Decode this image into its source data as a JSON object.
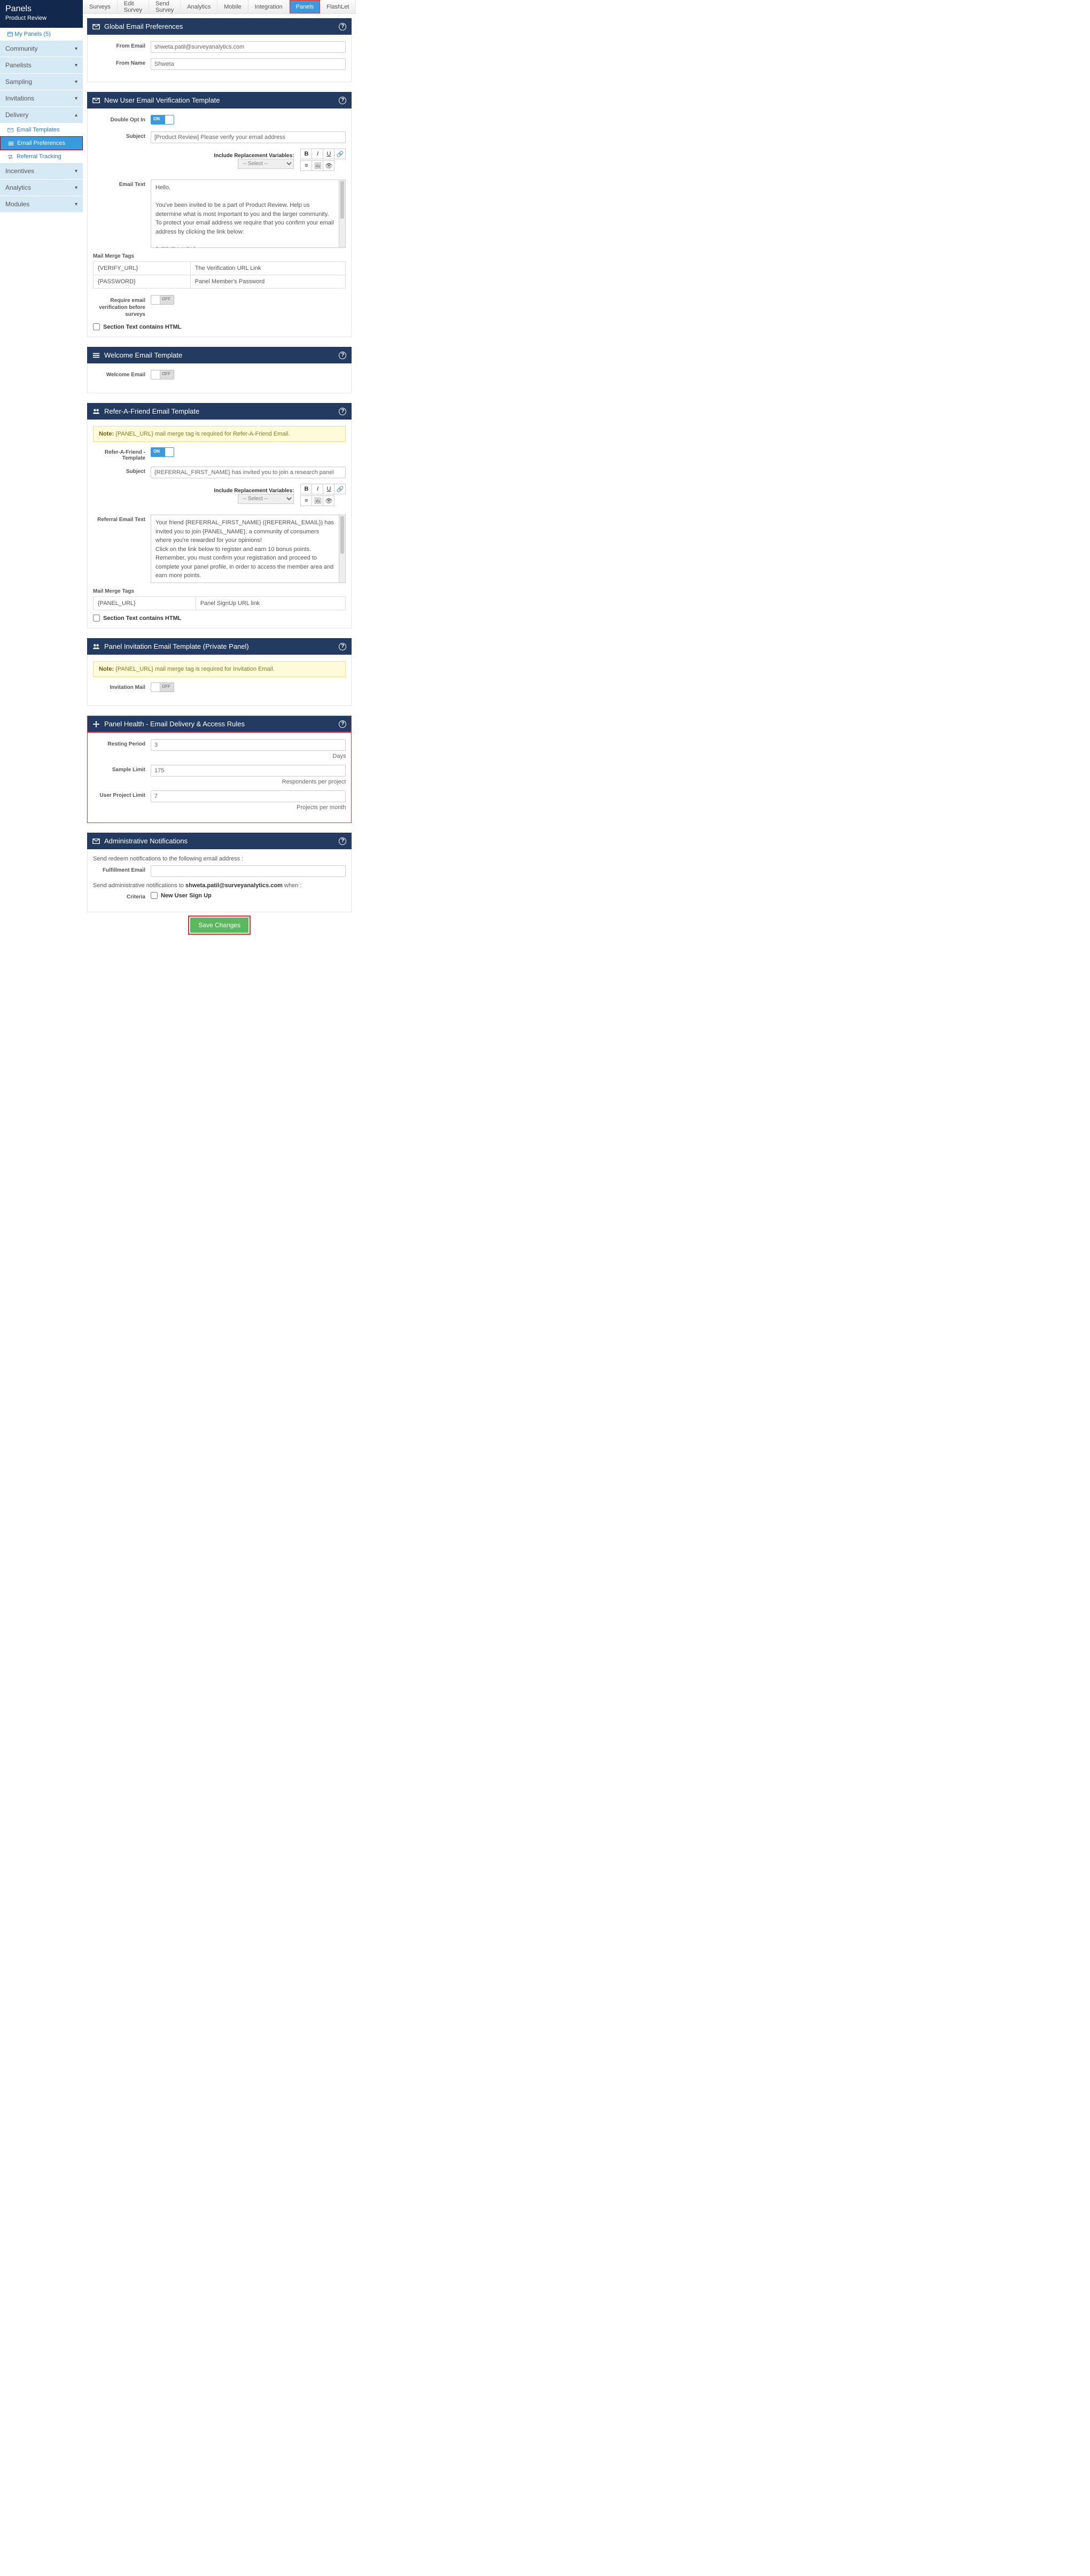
{
  "sidebar": {
    "title": "Panels",
    "subtitle": "Product Review",
    "mypanels": "My Panels (5)",
    "sections": {
      "community": "Community",
      "panelists": "Panelists",
      "sampling": "Sampling",
      "invitations": "Invitations",
      "delivery": "Delivery",
      "incentives": "Incentives",
      "analytics": "Analytics",
      "modules": "Modules"
    },
    "delivery_items": {
      "email_templates": "Email Templates",
      "email_prefs": "Email Preferences",
      "referral": "Referral Tracking"
    }
  },
  "topnav": [
    "Surveys",
    "Edit Survey",
    "Send Survey",
    "Analytics",
    "Mobile",
    "Integration",
    "Panels",
    "FlashLet"
  ],
  "topnav_active": 6,
  "global_email": {
    "title": "Global Email Preferences",
    "from_email_label": "From Email",
    "from_email_value": "shweta.patil@surveyanalytics.com",
    "from_name_label": "From Name",
    "from_name_value": "Shweta"
  },
  "verify": {
    "title": "New User Email Verification Template",
    "double_opt_label": "Double Opt In",
    "subject_label": "Subject",
    "subject_value": "[Product Review] Please verify your email address",
    "irv_label": "Include Replacement Variables:",
    "select_placeholder": "-- Select --",
    "email_text_label": "Email Text",
    "email_text": "Hello,\n\nYou've been invited to be a part of Product Review. Help us determine what is most important to you and the larger community.\nTo protect your email address we require that you confirm your email address by clicking the link below:\n\n{VERIFY_URL}\n\nThank You",
    "mm_label": "Mail Merge Tags",
    "mm": [
      [
        "{VERIFY_URL}",
        "The Verification URL Link"
      ],
      [
        "{PASSWORD}",
        "Panel Member's Password"
      ]
    ],
    "require_label": "Require email verification before surveys",
    "checkbox_label": "Section Text contains HTML"
  },
  "welcome": {
    "title": "Welcome Email Template",
    "welcome_label": "Welcome Email"
  },
  "refer": {
    "title": "Refer-A-Friend Email Template",
    "note_prefix": "Note:",
    "note_text": " {PANEL_URL} mail merge tag is required for Refer-A-Friend Email.",
    "template_label": "Refer-A-Friend - Template",
    "subject_label": "Subject",
    "subject_value": "{REFERRAL_FIRST_NAME} has invited you to join a research panel",
    "irv_label": "Include Replacement Variables:",
    "select_placeholder": "-- Select --",
    "text_label": "Referral Email Text",
    "text_value": "Your friend {REFERRAL_FIRST_NAME} ({REFERRAL_EMAIL}) has invited you to join {PANEL_NAME}, a community of consumers where you're rewarded for your opinions!\nClick on the link below to register and earn 10 bonus points. Remember, you must confirm your registration and proceed to complete your panel profile, in order to access the member area and earn more points.\n\n{PANEL_URL}\n\nIf you do not know the person sending this invitation, do not worry, simply",
    "mm_label": "Mail Merge Tags",
    "mm": [
      [
        "{PANEL_URL}",
        "Panel SignUp URL link"
      ]
    ],
    "checkbox_label": "Section Text contains HTML"
  },
  "invite": {
    "title": "Panel Invitation Email Template (Private Panel)",
    "note_prefix": "Note:",
    "note_text": " {PANEL_URL} mail merge tag is required for Invitation Email.",
    "mail_label": "Invitation Mail"
  },
  "health": {
    "title": "Panel Health - Email Delivery & Access Rules",
    "resting_label": "Resting Period",
    "resting_value": "3",
    "resting_hint": "Days",
    "sample_label": "Sample Limit",
    "sample_value": "175",
    "sample_hint": "Respondents per project",
    "user_label": "User Project Limit",
    "user_value": "7",
    "user_hint": "Projects per month"
  },
  "admin": {
    "title": "Administrative Notifications",
    "line1": "Send redeem notifications to the following email address :",
    "fulfillment_label": "Fulfillment Email",
    "line2_pre": "Send administrative notifications to ",
    "line2_bold": "shweta.patil@surveyanalytics.com",
    "line2_post": " when :",
    "criteria_label": "Criteria",
    "criteria_opt": "New User Sign Up"
  },
  "save_label": "Save Changes"
}
